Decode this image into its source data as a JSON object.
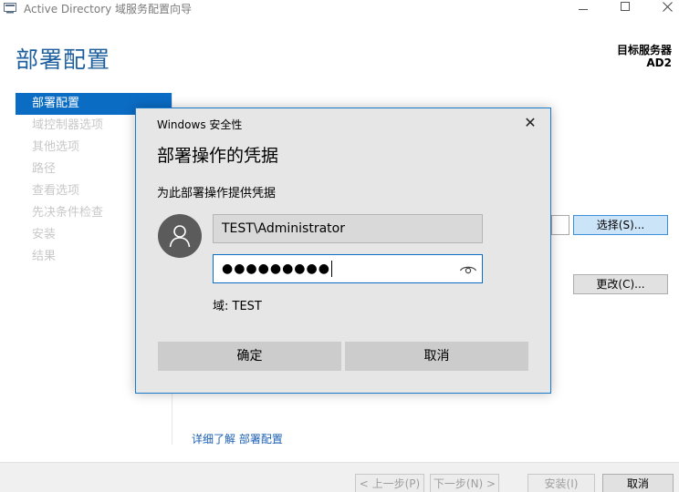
{
  "window": {
    "title": "Active Directory 域服务配置向导",
    "icons": {
      "app": "server-wizard-icon",
      "min": "minimize-icon",
      "max": "maximize-icon",
      "close": "close-icon"
    }
  },
  "header": {
    "page_title": "部署配置",
    "target_label": "目标服务器",
    "target_name": "AD2"
  },
  "sidebar": {
    "items": [
      {
        "label": "部署配置",
        "active": true
      },
      {
        "label": "域控制器选项",
        "active": false
      },
      {
        "label": "其他选项",
        "active": false
      },
      {
        "label": "路径",
        "active": false
      },
      {
        "label": "查看选项",
        "active": false
      },
      {
        "label": "先决条件检查",
        "active": false
      },
      {
        "label": "安装",
        "active": false
      },
      {
        "label": "结果",
        "active": false
      }
    ]
  },
  "main": {
    "select_button": "选择(S)...",
    "change_button": "更改(C)...",
    "learn_more": "详细了解 部署配置"
  },
  "footer": {
    "prev": "< 上一步(P)",
    "next": "下一步(N) >",
    "install": "安装(I)",
    "cancel": "取消"
  },
  "dialog": {
    "caption": "Windows 安全性",
    "close_glyph": "✕",
    "title": "部署操作的凭据",
    "subtitle": "为此部署操作提供凭据",
    "username": "TEST\\Administrator",
    "password_mask": "●●●●●●●●●",
    "domain": "域: TEST",
    "ok": "确定",
    "cancel": "取消"
  },
  "colors": {
    "accent": "#0b6cc4",
    "title_blue": "#1e5f9e",
    "dialog_border": "#1979ca",
    "dialog_bg": "#e6e6e6"
  }
}
